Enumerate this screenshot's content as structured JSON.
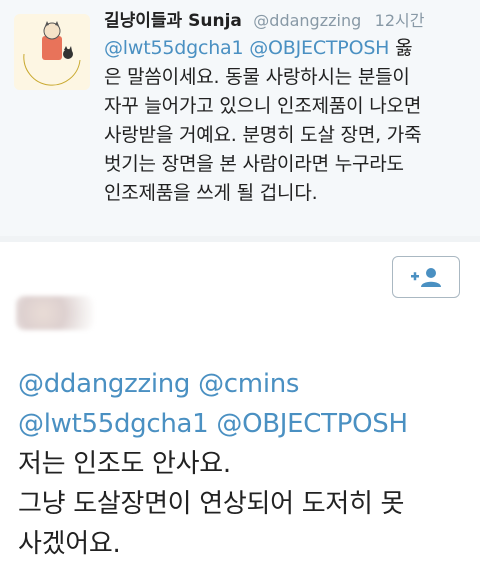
{
  "tweet1": {
    "display_name": "길냥이들과 Sunja",
    "handle": "@ddangzzing",
    "time": "12시간",
    "lines": [
      "@lwt55dgcha1 @OBJECTPOSH 옳",
      "은 말씀이세요. 동물 사랑하시는 분들이",
      "자꾸 늘어가고 있으니 인조제품이 나오면",
      "사랑받을 거예요. 분명히 도살 장면, 가죽",
      "벗기는 장면을 본 사람이라면 누구라도",
      "인조제품을 쓰게 될 겁니다."
    ]
  },
  "tweet2": {
    "mentions_line1": [
      "@ddangzzing",
      "@cmins"
    ],
    "mentions_line2": [
      "@lwt55dgcha1",
      "@OBJECTPOSH"
    ],
    "lines": [
      "저는 인조도 안사요.",
      "그냥 도살장면이 연상되어 도저히 못",
      "사겠어요."
    ]
  },
  "icons": {
    "follow": "add-user-icon",
    "avatar": "cat-on-moon-avatar"
  },
  "colors": {
    "mention": "#4a90c2",
    "follow_icon": "#4a90c2",
    "meta": "#8899a6"
  }
}
